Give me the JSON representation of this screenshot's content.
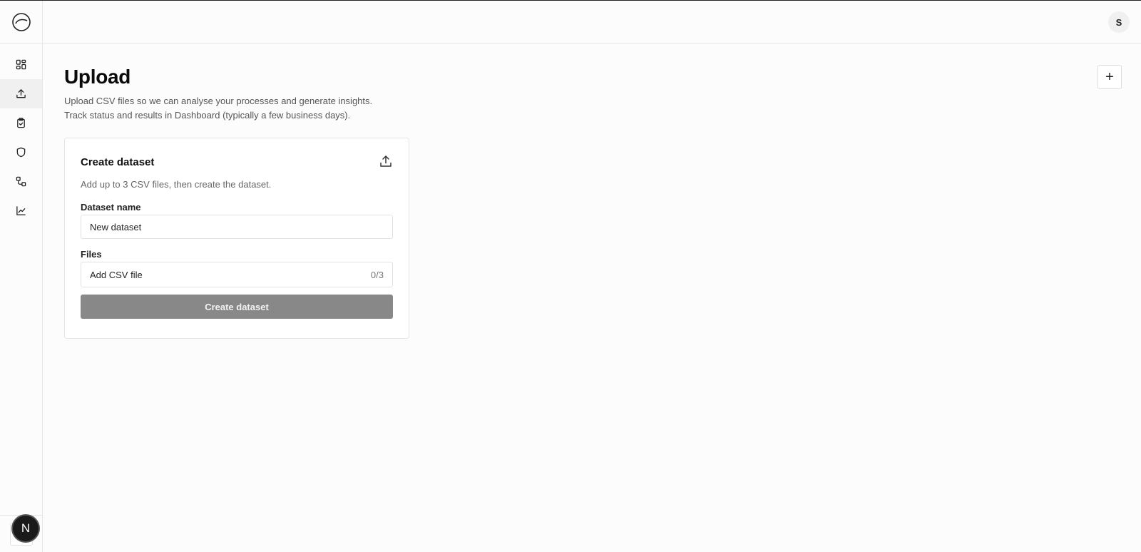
{
  "topbar": {
    "avatar_initial": "S"
  },
  "sidebar": {
    "items": [
      {
        "name": "dashboard-icon"
      },
      {
        "name": "upload-icon",
        "active": true
      },
      {
        "name": "clipboard-check-icon"
      },
      {
        "name": "shield-icon"
      },
      {
        "name": "workflow-icon"
      },
      {
        "name": "line-chart-icon"
      }
    ],
    "next_badge": "N"
  },
  "main": {
    "title": "Upload",
    "description_line1": "Upload CSV files so we can analyse your processes and generate insights.",
    "description_line2": "Track status and results in Dashboard (typically a few business days).",
    "add_button_label": "+"
  },
  "card": {
    "title": "Create dataset",
    "description": "Add up to 3 CSV files, then create the dataset.",
    "dataset_name_label": "Dataset name",
    "dataset_name_value": "New dataset",
    "files_label": "Files",
    "add_file_label": "Add CSV file",
    "file_count": "0/3",
    "create_button_label": "Create dataset"
  }
}
